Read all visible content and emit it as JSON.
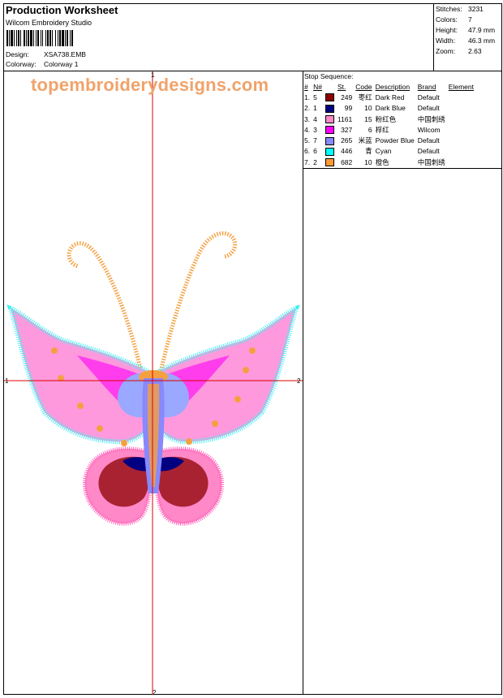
{
  "header": {
    "title": "Production Worksheet",
    "software": "Wilcom Embroidery Studio",
    "design_label": "Design:",
    "design_value": "XSA738.EMB",
    "colorway_label": "Colorway:",
    "colorway_value": "Colorway 1"
  },
  "stats": [
    {
      "label": "Stitches:",
      "value": "3231"
    },
    {
      "label": "Colors:",
      "value": "7"
    },
    {
      "label": "Height:",
      "value": "47.9 mm"
    },
    {
      "label": "Width:",
      "value": "46.3 mm"
    },
    {
      "label": "Zoom:",
      "value": "2.63"
    }
  ],
  "stop_sequence": {
    "title": "Stop Sequence:",
    "columns": [
      "#",
      "N#",
      "St.",
      "Code",
      "Description",
      "Brand",
      "Element"
    ],
    "rows": [
      {
        "num": "1.",
        "n": "5",
        "color": "#8b0000",
        "st": "249",
        "code": "枣红",
        "desc": "Dark Red",
        "brand": "Default"
      },
      {
        "num": "2.",
        "n": "1",
        "color": "#000080",
        "st": "99",
        "code": "10",
        "desc": "Dark Blue",
        "brand": "Default"
      },
      {
        "num": "3.",
        "n": "4",
        "color": "#ff88c8",
        "st": "1161",
        "code": "15",
        "desc": "粉红色",
        "brand": "中国刺绣"
      },
      {
        "num": "4.",
        "n": "3",
        "color": "#ff00ff",
        "st": "327",
        "code": "6",
        "desc": "桴红",
        "brand": "Wilcom"
      },
      {
        "num": "5.",
        "n": "7",
        "color": "#8888ff",
        "st": "265",
        "code": "米蓝",
        "desc": "Powder Blue",
        "brand": "Default"
      },
      {
        "num": "6.",
        "n": "6",
        "color": "#00ffff",
        "st": "446",
        "code": "青",
        "desc": "Cyan",
        "brand": "Default"
      },
      {
        "num": "7.",
        "n": "2",
        "color": "#ff9933",
        "st": "682",
        "code": "10",
        "desc": "橙色",
        "brand": "中国刺绣"
      }
    ]
  },
  "watermark": "topembroiderydesigns.com",
  "axis_labels": {
    "top": "1",
    "left": "1",
    "right": "2",
    "bottom": "2"
  }
}
